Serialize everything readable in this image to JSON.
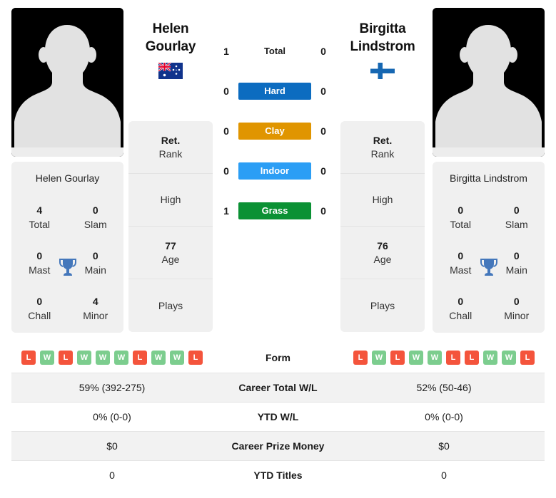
{
  "players": {
    "left": {
      "first_name": "Helen",
      "last_name": "Gourlay",
      "full_name": "Helen Gourlay",
      "country_flag": "australia-flag",
      "rank_value": "Ret.",
      "rank_label": "Rank",
      "high_value": "",
      "high_label": "High",
      "age_value": "77",
      "age_label": "Age",
      "plays_value": "",
      "plays_label": "Plays",
      "titles": {
        "total_value": "4",
        "total_label": "Total",
        "slam_value": "0",
        "slam_label": "Slam",
        "mast_value": "0",
        "mast_label": "Mast",
        "main_value": "0",
        "main_label": "Main",
        "chall_value": "0",
        "chall_label": "Chall",
        "minor_value": "4",
        "minor_label": "Minor"
      },
      "form": [
        "L",
        "W",
        "L",
        "W",
        "W",
        "W",
        "L",
        "W",
        "W",
        "L"
      ],
      "career_total_wl": "59% (392-275)",
      "ytd_wl": "0% (0-0)",
      "career_prize_money": "$0",
      "ytd_titles": "0"
    },
    "right": {
      "first_name": "Birgitta",
      "last_name": "Lindstrom",
      "full_name": "Birgitta Lindstrom",
      "country_flag": "finland-flag",
      "rank_value": "Ret.",
      "rank_label": "Rank",
      "high_value": "",
      "high_label": "High",
      "age_value": "76",
      "age_label": "Age",
      "plays_value": "",
      "plays_label": "Plays",
      "titles": {
        "total_value": "0",
        "total_label": "Total",
        "slam_value": "0",
        "slam_label": "Slam",
        "mast_value": "0",
        "mast_label": "Mast",
        "main_value": "0",
        "main_label": "Main",
        "chall_value": "0",
        "chall_label": "Chall",
        "minor_value": "0",
        "minor_label": "Minor"
      },
      "form": [
        "L",
        "W",
        "L",
        "W",
        "W",
        "L",
        "L",
        "W",
        "W",
        "L"
      ],
      "career_total_wl": "52% (50-46)",
      "ytd_wl": "0% (0-0)",
      "career_prize_money": "$0",
      "ytd_titles": "0"
    }
  },
  "surfaces": [
    {
      "label": "Total",
      "left": "1",
      "right": "0",
      "color": "none",
      "style": "plain"
    },
    {
      "label": "Hard",
      "left": "0",
      "right": "0",
      "color": "#0c6cc0",
      "style": "badge"
    },
    {
      "label": "Clay",
      "left": "0",
      "right": "0",
      "color": "#e09500",
      "style": "badge"
    },
    {
      "label": "Indoor",
      "left": "0",
      "right": "0",
      "color": "#2b9ef5",
      "style": "badge"
    },
    {
      "label": "Grass",
      "left": "1",
      "right": "0",
      "color": "#0b9134",
      "style": "badge"
    }
  ],
  "table": {
    "rows": [
      {
        "label": "Form",
        "type": "form",
        "left_key": "form",
        "right_key": "form"
      },
      {
        "label": "Career Total W/L",
        "type": "text",
        "left_key": "career_total_wl",
        "right_key": "career_total_wl"
      },
      {
        "label": "YTD W/L",
        "type": "text",
        "left_key": "ytd_wl",
        "right_key": "ytd_wl"
      },
      {
        "label": "Career Prize Money",
        "type": "text",
        "left_key": "career_prize_money",
        "right_key": "career_prize_money"
      },
      {
        "label": "YTD Titles",
        "type": "text",
        "left_key": "ytd_titles",
        "right_key": "ytd_titles"
      }
    ]
  },
  "colors": {
    "win_badge": "#7ccd8e",
    "loss_badge": "#f4543c",
    "trophy": "#4477bb",
    "card_bg": "#f0f0f0",
    "row_alt_bg": "#f2f2f2"
  }
}
